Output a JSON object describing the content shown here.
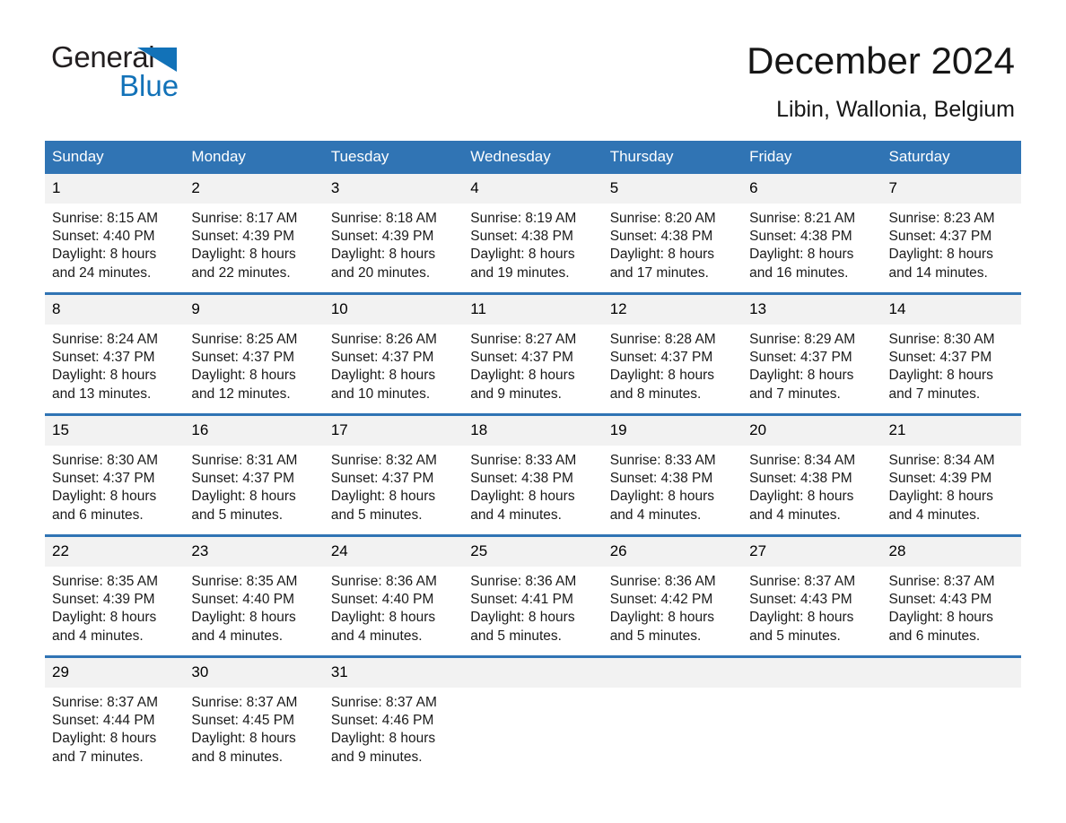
{
  "brand": {
    "name_part1": "General",
    "name_part2": "Blue",
    "triangle_color": "#1272b8"
  },
  "header": {
    "month_title": "December 2024",
    "location": "Libin, Wallonia, Belgium",
    "accent_color": "#3074b4",
    "daynum_band_color": "#f2f2f2"
  },
  "weekday_headers": [
    "Sunday",
    "Monday",
    "Tuesday",
    "Wednesday",
    "Thursday",
    "Friday",
    "Saturday"
  ],
  "weeks": [
    [
      {
        "day": "1",
        "sunrise": "Sunrise: 8:15 AM",
        "sunset": "Sunset: 4:40 PM",
        "daylight_line1": "Daylight: 8 hours",
        "daylight_line2": "and 24 minutes."
      },
      {
        "day": "2",
        "sunrise": "Sunrise: 8:17 AM",
        "sunset": "Sunset: 4:39 PM",
        "daylight_line1": "Daylight: 8 hours",
        "daylight_line2": "and 22 minutes."
      },
      {
        "day": "3",
        "sunrise": "Sunrise: 8:18 AM",
        "sunset": "Sunset: 4:39 PM",
        "daylight_line1": "Daylight: 8 hours",
        "daylight_line2": "and 20 minutes."
      },
      {
        "day": "4",
        "sunrise": "Sunrise: 8:19 AM",
        "sunset": "Sunset: 4:38 PM",
        "daylight_line1": "Daylight: 8 hours",
        "daylight_line2": "and 19 minutes."
      },
      {
        "day": "5",
        "sunrise": "Sunrise: 8:20 AM",
        "sunset": "Sunset: 4:38 PM",
        "daylight_line1": "Daylight: 8 hours",
        "daylight_line2": "and 17 minutes."
      },
      {
        "day": "6",
        "sunrise": "Sunrise: 8:21 AM",
        "sunset": "Sunset: 4:38 PM",
        "daylight_line1": "Daylight: 8 hours",
        "daylight_line2": "and 16 minutes."
      },
      {
        "day": "7",
        "sunrise": "Sunrise: 8:23 AM",
        "sunset": "Sunset: 4:37 PM",
        "daylight_line1": "Daylight: 8 hours",
        "daylight_line2": "and 14 minutes."
      }
    ],
    [
      {
        "day": "8",
        "sunrise": "Sunrise: 8:24 AM",
        "sunset": "Sunset: 4:37 PM",
        "daylight_line1": "Daylight: 8 hours",
        "daylight_line2": "and 13 minutes."
      },
      {
        "day": "9",
        "sunrise": "Sunrise: 8:25 AM",
        "sunset": "Sunset: 4:37 PM",
        "daylight_line1": "Daylight: 8 hours",
        "daylight_line2": "and 12 minutes."
      },
      {
        "day": "10",
        "sunrise": "Sunrise: 8:26 AM",
        "sunset": "Sunset: 4:37 PM",
        "daylight_line1": "Daylight: 8 hours",
        "daylight_line2": "and 10 minutes."
      },
      {
        "day": "11",
        "sunrise": "Sunrise: 8:27 AM",
        "sunset": "Sunset: 4:37 PM",
        "daylight_line1": "Daylight: 8 hours",
        "daylight_line2": "and 9 minutes."
      },
      {
        "day": "12",
        "sunrise": "Sunrise: 8:28 AM",
        "sunset": "Sunset: 4:37 PM",
        "daylight_line1": "Daylight: 8 hours",
        "daylight_line2": "and 8 minutes."
      },
      {
        "day": "13",
        "sunrise": "Sunrise: 8:29 AM",
        "sunset": "Sunset: 4:37 PM",
        "daylight_line1": "Daylight: 8 hours",
        "daylight_line2": "and 7 minutes."
      },
      {
        "day": "14",
        "sunrise": "Sunrise: 8:30 AM",
        "sunset": "Sunset: 4:37 PM",
        "daylight_line1": "Daylight: 8 hours",
        "daylight_line2": "and 7 minutes."
      }
    ],
    [
      {
        "day": "15",
        "sunrise": "Sunrise: 8:30 AM",
        "sunset": "Sunset: 4:37 PM",
        "daylight_line1": "Daylight: 8 hours",
        "daylight_line2": "and 6 minutes."
      },
      {
        "day": "16",
        "sunrise": "Sunrise: 8:31 AM",
        "sunset": "Sunset: 4:37 PM",
        "daylight_line1": "Daylight: 8 hours",
        "daylight_line2": "and 5 minutes."
      },
      {
        "day": "17",
        "sunrise": "Sunrise: 8:32 AM",
        "sunset": "Sunset: 4:37 PM",
        "daylight_line1": "Daylight: 8 hours",
        "daylight_line2": "and 5 minutes."
      },
      {
        "day": "18",
        "sunrise": "Sunrise: 8:33 AM",
        "sunset": "Sunset: 4:38 PM",
        "daylight_line1": "Daylight: 8 hours",
        "daylight_line2": "and 4 minutes."
      },
      {
        "day": "19",
        "sunrise": "Sunrise: 8:33 AM",
        "sunset": "Sunset: 4:38 PM",
        "daylight_line1": "Daylight: 8 hours",
        "daylight_line2": "and 4 minutes."
      },
      {
        "day": "20",
        "sunrise": "Sunrise: 8:34 AM",
        "sunset": "Sunset: 4:38 PM",
        "daylight_line1": "Daylight: 8 hours",
        "daylight_line2": "and 4 minutes."
      },
      {
        "day": "21",
        "sunrise": "Sunrise: 8:34 AM",
        "sunset": "Sunset: 4:39 PM",
        "daylight_line1": "Daylight: 8 hours",
        "daylight_line2": "and 4 minutes."
      }
    ],
    [
      {
        "day": "22",
        "sunrise": "Sunrise: 8:35 AM",
        "sunset": "Sunset: 4:39 PM",
        "daylight_line1": "Daylight: 8 hours",
        "daylight_line2": "and 4 minutes."
      },
      {
        "day": "23",
        "sunrise": "Sunrise: 8:35 AM",
        "sunset": "Sunset: 4:40 PM",
        "daylight_line1": "Daylight: 8 hours",
        "daylight_line2": "and 4 minutes."
      },
      {
        "day": "24",
        "sunrise": "Sunrise: 8:36 AM",
        "sunset": "Sunset: 4:40 PM",
        "daylight_line1": "Daylight: 8 hours",
        "daylight_line2": "and 4 minutes."
      },
      {
        "day": "25",
        "sunrise": "Sunrise: 8:36 AM",
        "sunset": "Sunset: 4:41 PM",
        "daylight_line1": "Daylight: 8 hours",
        "daylight_line2": "and 5 minutes."
      },
      {
        "day": "26",
        "sunrise": "Sunrise: 8:36 AM",
        "sunset": "Sunset: 4:42 PM",
        "daylight_line1": "Daylight: 8 hours",
        "daylight_line2": "and 5 minutes."
      },
      {
        "day": "27",
        "sunrise": "Sunrise: 8:37 AM",
        "sunset": "Sunset: 4:43 PM",
        "daylight_line1": "Daylight: 8 hours",
        "daylight_line2": "and 5 minutes."
      },
      {
        "day": "28",
        "sunrise": "Sunrise: 8:37 AM",
        "sunset": "Sunset: 4:43 PM",
        "daylight_line1": "Daylight: 8 hours",
        "daylight_line2": "and 6 minutes."
      }
    ],
    [
      {
        "day": "29",
        "sunrise": "Sunrise: 8:37 AM",
        "sunset": "Sunset: 4:44 PM",
        "daylight_line1": "Daylight: 8 hours",
        "daylight_line2": "and 7 minutes."
      },
      {
        "day": "30",
        "sunrise": "Sunrise: 8:37 AM",
        "sunset": "Sunset: 4:45 PM",
        "daylight_line1": "Daylight: 8 hours",
        "daylight_line2": "and 8 minutes."
      },
      {
        "day": "31",
        "sunrise": "Sunrise: 8:37 AM",
        "sunset": "Sunset: 4:46 PM",
        "daylight_line1": "Daylight: 8 hours",
        "daylight_line2": "and 9 minutes."
      },
      {
        "day": "",
        "sunrise": "",
        "sunset": "",
        "daylight_line1": "",
        "daylight_line2": ""
      },
      {
        "day": "",
        "sunrise": "",
        "sunset": "",
        "daylight_line1": "",
        "daylight_line2": ""
      },
      {
        "day": "",
        "sunrise": "",
        "sunset": "",
        "daylight_line1": "",
        "daylight_line2": ""
      },
      {
        "day": "",
        "sunrise": "",
        "sunset": "",
        "daylight_line1": "",
        "daylight_line2": ""
      }
    ]
  ]
}
